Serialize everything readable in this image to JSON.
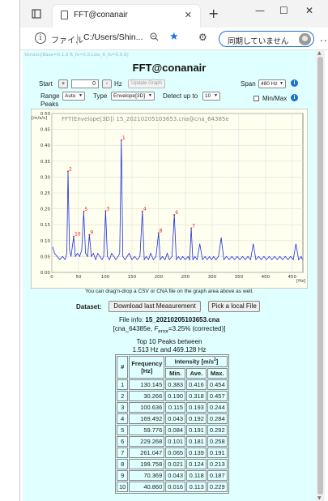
{
  "browser": {
    "tab_title": "FFT@conanair",
    "tab_close": "✕",
    "new_tab": "+",
    "win_min": "—",
    "win_max": "☐",
    "win_close": "✕",
    "file_label": "ファイル",
    "url": "C:/Users/Shin...",
    "sync_label": "同期していません",
    "more": "...",
    "icons": [
      "tab-actions-icon",
      "page-icon",
      "info-icon",
      "zoom-icon",
      "favorite-star-icon",
      "extensions-icon",
      "profile-avatar-icon"
    ]
  },
  "page": {
    "version_text": "Version[Base=0.1,0 ft_fs=0.0,Low_ft_fs=0.0.6]",
    "title": "FFT@conanair",
    "controls": {
      "start_label": "Start",
      "plus": "+",
      "start_value": "0",
      "minus": "-",
      "hz_label": "Hz",
      "update_graph": "Update Graph",
      "span_label": "Span",
      "span_value": "480 Hz",
      "help": "i",
      "range_label": "Range",
      "range_value": "Auto",
      "type_label": "Type",
      "type_value": "Envelope[3D]",
      "detect_label": "Detect up to",
      "detect_value": "10",
      "peaks_label": "Peaks",
      "minmax_label": "Min/Max"
    },
    "drop_note": "You can drag'n-drop a CSV or CNA file on the graph area above as well.",
    "dataset_label": "Dataset:",
    "download_button": "Download last Measurement",
    "pick_button": "Pick a local File",
    "file_info_label": "File info:",
    "file_name": "15_20210205103653.cna",
    "device_text": "[cna_64385e,",
    "ferror_text": "F",
    "ferror_sub": "error",
    "ferror_value": "=3.25% (corrected)]",
    "peaks_title": "Top 10 Peaks between",
    "peaks_range": "1.513 Hz and 469.128 Hz",
    "table": {
      "col_num": "#",
      "col_freq": "Frequency",
      "col_freq_unit": "[Hz]",
      "col_int": "Intensity [m/s",
      "col_int_sup": "2",
      "col_int_end": "]",
      "col_min": "Min.",
      "col_ave": "Ave.",
      "col_max": "Max.",
      "rows": [
        [
          "1",
          "130.145",
          "0.383",
          "0.416",
          "0.454"
        ],
        [
          "2",
          "30.266",
          "0.190",
          "0.318",
          "0.457"
        ],
        [
          "3",
          "100.636",
          "0.115",
          "0.193",
          "0.244"
        ],
        [
          "4",
          "169.492",
          "0.043",
          "0.192",
          "0.284"
        ],
        [
          "5",
          "59.776",
          "0.084",
          "0.191",
          "0.292"
        ],
        [
          "6",
          "229.268",
          "0.101",
          "0.181",
          "0.258"
        ],
        [
          "7",
          "261.047",
          "0.065",
          "0.139",
          "0.191"
        ],
        [
          "8",
          "199.758",
          "0.021",
          "0.124",
          "0.213"
        ],
        [
          "9",
          "70.369",
          "0.043",
          "0.118",
          "0.187"
        ],
        [
          "10",
          "40.860",
          "0.016",
          "0.113",
          "0.229"
        ]
      ]
    }
  },
  "chart_data": {
    "type": "line",
    "title": "FFT(Envelope[3D])  15_20210205103653.cna@cna_64385e",
    "ylabel": "[m/s/s]",
    "xlabel": "[Hz]",
    "xlim": [
      0,
      470
    ],
    "ylim": [
      0,
      0.5
    ],
    "xticks": [
      0,
      50,
      100,
      150,
      200,
      250,
      300,
      350,
      400,
      450
    ],
    "yticks": [
      0.0,
      0.05,
      0.1,
      0.15,
      0.2,
      0.25,
      0.3,
      0.35,
      0.4,
      0.45,
      0.5
    ],
    "ytick_labels": [
      "0.00",
      "0.05",
      "0.10",
      "0.15",
      "0.20",
      "0.25",
      "0.30",
      "0.35",
      "0.40",
      "0.45",
      "0.50"
    ],
    "grid": true,
    "line_color": "#1f2fd8",
    "peak_label_color": "#e02020",
    "series": [
      {
        "x": [
          1.5,
          5,
          10,
          15,
          20,
          25,
          28,
          30.3,
          33,
          36,
          40.9,
          44,
          48,
          52,
          56,
          59.8,
          63,
          67,
          70.4,
          74,
          78,
          82,
          86,
          90,
          94,
          97,
          100.6,
          104,
          108,
          112,
          116,
          120,
          124,
          127,
          130.1,
          133,
          137,
          141,
          145,
          150,
          155,
          160,
          165,
          169.5,
          173,
          177,
          181,
          185,
          190,
          195,
          199.8,
          203,
          207,
          212,
          216,
          220,
          225,
          229.3,
          233,
          237,
          241,
          245,
          250,
          255,
          258,
          261,
          264,
          268,
          272,
          277,
          282,
          287,
          291,
          295,
          299,
          303,
          307,
          312,
          317,
          322,
          327,
          332,
          337,
          342,
          347,
          352,
          357,
          362,
          367,
          372,
          377,
          382,
          387,
          392,
          397,
          402,
          407,
          412,
          417,
          422,
          427,
          432,
          437,
          442,
          447,
          452,
          457,
          462,
          467,
          469
        ],
        "y": [
          0.08,
          0.06,
          0.05,
          0.04,
          0.05,
          0.04,
          0.06,
          0.318,
          0.07,
          0.05,
          0.113,
          0.05,
          0.06,
          0.05,
          0.07,
          0.191,
          0.06,
          0.05,
          0.118,
          0.05,
          0.06,
          0.04,
          0.06,
          0.05,
          0.04,
          0.05,
          0.193,
          0.05,
          0.04,
          0.06,
          0.05,
          0.04,
          0.05,
          0.06,
          0.416,
          0.05,
          0.04,
          0.05,
          0.06,
          0.04,
          0.05,
          0.04,
          0.05,
          0.192,
          0.04,
          0.05,
          0.04,
          0.06,
          0.04,
          0.05,
          0.124,
          0.04,
          0.05,
          0.04,
          0.06,
          0.04,
          0.05,
          0.181,
          0.04,
          0.05,
          0.04,
          0.05,
          0.04,
          0.05,
          0.04,
          0.139,
          0.04,
          0.05,
          0.04,
          0.09,
          0.04,
          0.05,
          0.04,
          0.05,
          0.04,
          0.05,
          0.04,
          0.05,
          0.11,
          0.04,
          0.05,
          0.04,
          0.05,
          0.04,
          0.05,
          0.04,
          0.05,
          0.04,
          0.05,
          0.04,
          0.09,
          0.04,
          0.05,
          0.04,
          0.05,
          0.04,
          0.05,
          0.04,
          0.05,
          0.04,
          0.05,
          0.04,
          0.05,
          0.04,
          0.05,
          0.04,
          0.09,
          0.04,
          0.05,
          0.04
        ]
      }
    ],
    "peak_labels": [
      {
        "label": "1",
        "x": 130.145,
        "y": 0.416
      },
      {
        "label": "2",
        "x": 30.266,
        "y": 0.318
      },
      {
        "label": "3",
        "x": 100.636,
        "y": 0.193
      },
      {
        "label": "4",
        "x": 169.492,
        "y": 0.192
      },
      {
        "label": "5",
        "x": 59.776,
        "y": 0.191
      },
      {
        "label": "6",
        "x": 229.268,
        "y": 0.181
      },
      {
        "label": "7",
        "x": 261.047,
        "y": 0.139
      },
      {
        "label": "8",
        "x": 199.758,
        "y": 0.124
      },
      {
        "label": "9",
        "x": 70.369,
        "y": 0.118
      },
      {
        "label": "10",
        "x": 40.86,
        "y": 0.113
      }
    ]
  }
}
